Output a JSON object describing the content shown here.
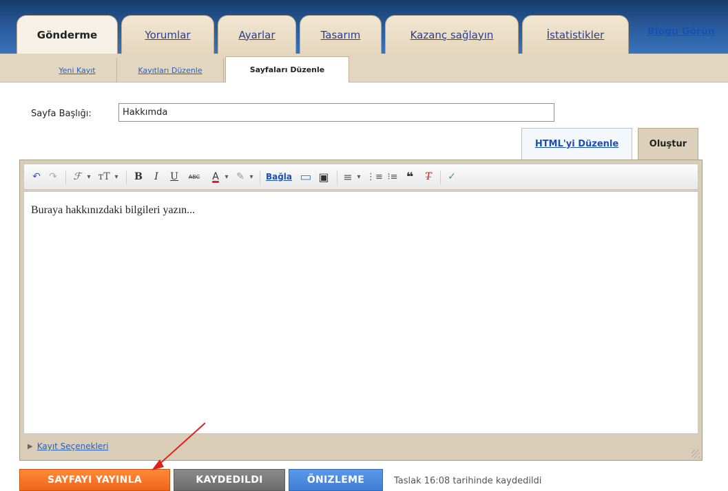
{
  "main_tabs": [
    {
      "label": "Gönderme"
    },
    {
      "label": "Yorumlar"
    },
    {
      "label": "Ayarlar"
    },
    {
      "label": "Tasarım"
    },
    {
      "label": "Kazanç sağlayın"
    },
    {
      "label": "İstatistikler"
    }
  ],
  "view_blog_link": "Blogu Görün",
  "sub_tabs": [
    {
      "label": "Yeni Kayıt"
    },
    {
      "label": "Kayıtları Düzenle"
    },
    {
      "label": "Sayfaları Düzenle"
    }
  ],
  "page_title": {
    "label": "Sayfa Başlığı:",
    "value": "Hakkımda"
  },
  "editor_modes": {
    "html": "HTML'yi Düzenle",
    "compose": "Oluştur"
  },
  "toolbar": {
    "undo_icon": "↶",
    "redo_icon": "↷",
    "font_icon": "ℱ",
    "font_size_icon": "тT",
    "dropdown_icon": "▾",
    "bold": "B",
    "italic": "I",
    "underline": "U",
    "strikethrough": "ABC",
    "text_color": "A",
    "highlight_icon": "✎",
    "link": "Bağla",
    "image_icon": "▭",
    "video_icon": "▣",
    "align_icon": "≡",
    "numbered_list_icon": "⋮≡",
    "bullet_list_icon": "⁝≡",
    "quote_icon": "❝",
    "clear_format_icon": "T̶",
    "spellcheck_icon": "✓"
  },
  "editor_content": "Buraya hakkınızdaki bilgileri yazın...",
  "post_options": "Kayıt Seçenekleri",
  "buttons": {
    "publish": "SAYFAYI YAYINLA",
    "saved": "KAYDEDILDI",
    "preview": "ÖNIZLEME"
  },
  "status": "Taslak 16:08 tarihinde kaydedildi",
  "colors": {
    "publish": "#f0651a",
    "saved": "#6d6d6d",
    "preview": "#3f7fd6",
    "arrow": "#e0201a"
  }
}
